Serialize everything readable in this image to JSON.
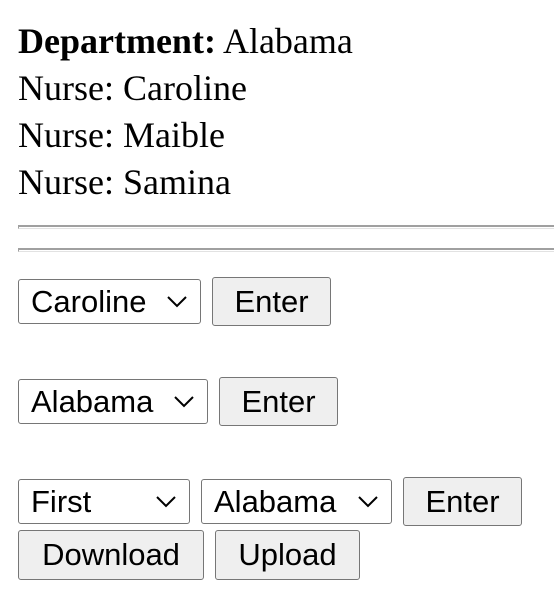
{
  "info": {
    "department_label": "Department:",
    "department_value": "Alabama",
    "nurses": [
      {
        "prefix": "Nurse:",
        "name": "Caroline"
      },
      {
        "prefix": "Nurse:",
        "name": "Maible"
      },
      {
        "prefix": "Nurse:",
        "name": "Samina"
      }
    ]
  },
  "form1": {
    "nurse_select_value": "Caroline",
    "enter_label": "Enter"
  },
  "form2": {
    "department_select_value": "Alabama",
    "enter_label": "Enter"
  },
  "form3": {
    "order_select_value": "First",
    "department_select_value": "Alabama",
    "enter_label": "Enter",
    "download_label": "Download",
    "upload_label": "Upload"
  },
  "icons": {
    "dropdown": "chevron-down-icon"
  }
}
